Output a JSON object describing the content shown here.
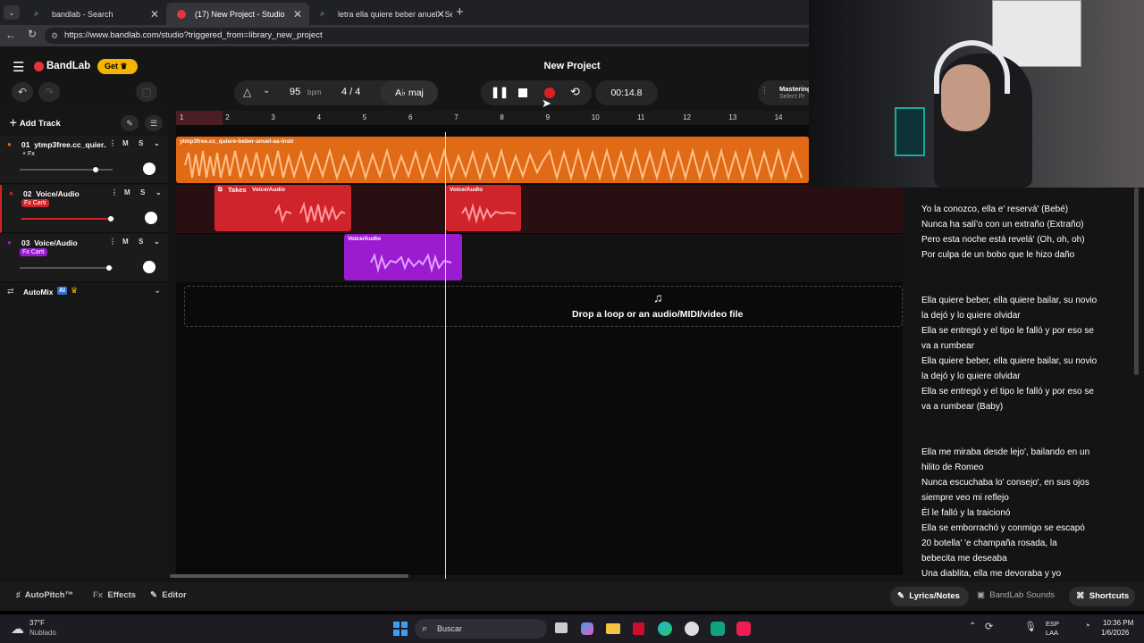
{
  "browser": {
    "tabs": [
      {
        "title": "bandlab - Search"
      },
      {
        "title": "(17) New Project - Studio"
      },
      {
        "title": "letra ella quiere beber anuel - Sear"
      }
    ],
    "url": "https://www.bandlab.com/studio?triggered_from=library_new_project"
  },
  "app": {
    "brand": "BandLab",
    "get_label": "Get",
    "project_title": "New Project",
    "bpm": "95",
    "bpm_unit": "bpm",
    "time_signature": "4 / 4",
    "key": "A♭ maj",
    "timer": "00:14.8",
    "mastering_label": "Mastering",
    "mastering_sub": "Select Pr",
    "add_track": "Add Track",
    "automix": "AutoMix",
    "automix_badge": "AI",
    "drop_text": "Drop a loop or an audio/MIDI/video file"
  },
  "ruler": [
    "1",
    "2",
    "3",
    "4",
    "5",
    "6",
    "7",
    "8",
    "9",
    "10",
    "11",
    "12",
    "13",
    "14"
  ],
  "tracks": [
    {
      "num": "01",
      "name": "ytmp3free.cc_quier...",
      "m": "M",
      "s": "S",
      "fx": "+ Fx",
      "vol": 0.72,
      "color": "#e06a16"
    },
    {
      "num": "02",
      "name": "Voice/Audio",
      "m": "M",
      "s": "S",
      "fx": "Fx Carti",
      "vol": 0.8,
      "color": "#d0242b"
    },
    {
      "num": "03",
      "name": "Voice/Audio",
      "m": "M",
      "s": "S",
      "fx": "Fx Carti",
      "vol": 0.8,
      "color": "#9b1cd0"
    }
  ],
  "clips": {
    "track1": "ytmp3free.cc_quiere-beber-anuel-aa-instr",
    "takes": "Takes",
    "voice": "Voice/Audio"
  },
  "lyrics": [
    "Yo la conozco, ella e' reservá' (Bebé)",
    "Nunca ha salí'o con un extraño (Extraño)",
    "Pero esta noche está revelá' (Oh, oh, oh)",
    "Por culpa de un bobo que le hizo daño",
    "",
    "",
    "Ella quiere beber, ella quiere bailar, su novio",
    "la dejó y lo quiere olvidar",
    "Ella se entregó y el tipo le falló y por eso se",
    "va a rumbear",
    "Ella quiere beber, ella quiere bailar, su novio",
    "la dejó y lo quiere olvidar",
    "Ella se entregó y el tipo le falló y por eso se",
    "va a rumbear (Baby)",
    "",
    "",
    "Ella me miraba desde lejo', bailando en un",
    "hilito de Romeo",
    "Nunca escuchaba lo' consejo', en sus ojos",
    "siempre veo mi reflejo",
    "Él le falló y la traicionó",
    "Ella se emborrachó y conmigo se escapó",
    "20 botella' 'e champaña rosada, la",
    "bebecita me deseaba",
    "Una diablita, ella me devoraba y yo"
  ],
  "bottom": {
    "autopitch": "AutoPitch™",
    "effects": "Effects",
    "editor": "Editor",
    "lyrics_notes": "Lyrics/Notes",
    "sounds": "BandLab Sounds",
    "shortcuts": "Shortcuts"
  },
  "taskbar": {
    "temp": "37°F",
    "weather": "Nublado",
    "search": "Buscar",
    "lang1": "ESP",
    "lang2": "LAA",
    "time": "10:36 PM",
    "date": "1/6/2026"
  }
}
